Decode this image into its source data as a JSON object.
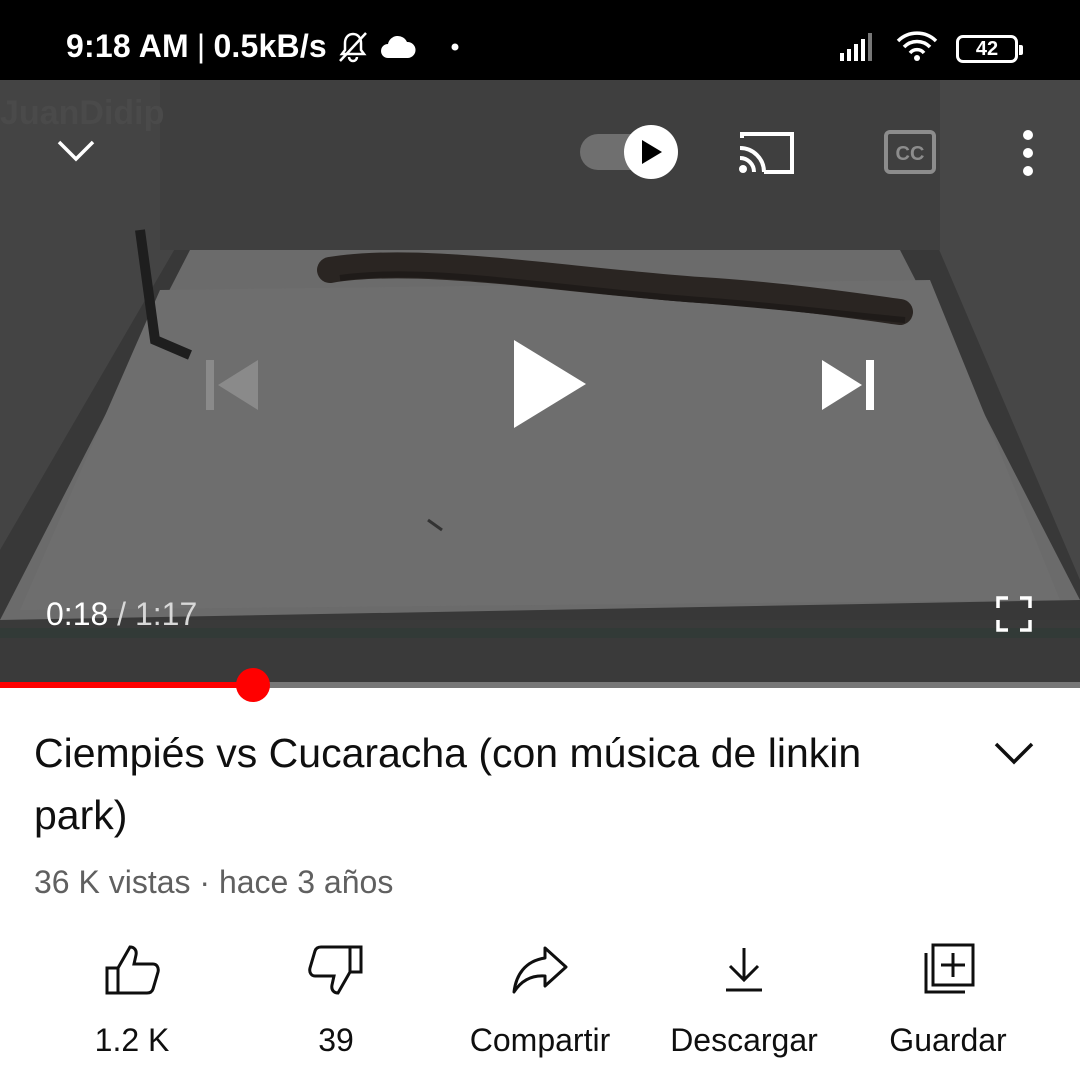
{
  "status_bar": {
    "time": "9:18 AM",
    "separator": "|",
    "speed": "0.5kB/s",
    "battery": "42"
  },
  "player": {
    "watermark": "JuanDidip",
    "current_time": "0:18",
    "time_separator": "/",
    "duration": "1:17",
    "progress": 0.234
  },
  "video": {
    "title": "Ciempiés vs Cucaracha (con música de linkin park)",
    "meta": "36 K vistas · hace 3 años"
  },
  "actions": {
    "like": "1.2 K",
    "dislike": "39",
    "share": "Compartir",
    "download": "Descargar",
    "save": "Guardar"
  },
  "colors": {
    "accent": "#ff0000",
    "player_bg": "#3c3c3c"
  }
}
